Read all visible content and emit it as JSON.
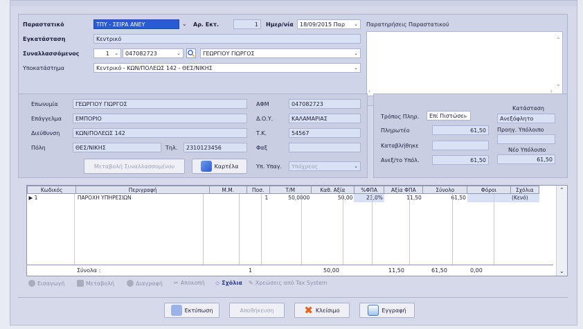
{
  "header": {
    "doc_label": "Παραστατικό",
    "doc_value": "ΤΠΥ - ΣΕΙΡΑ ΑΝΕΥ",
    "series_label": "Αρ. Εκτ.",
    "series_value": "1",
    "date_label": "Ημερ/νία",
    "date_value": "18/09/2015 Παρ",
    "notes_label": "Παρατηρήσεις Παραστατικού",
    "installation_label": "Εγκατάσταση",
    "installation_value": "Κεντρικό",
    "trader_label": "Συναλλασσόμενος",
    "trader_code": "1",
    "trader_afm": "047082723",
    "trader_name": "ΓΕΩΡΓΙΟΥ ΓΙΩΡΓΟΣ",
    "branch_label": "Υποκατάστημα",
    "branch_value": "Κεντρικό - ΚΩΝ/ΠΟΛΕΩΣ 142 - ΘΕΣ/ΝΙΚΗΣ"
  },
  "customer": {
    "name_label": "Επωνυμία",
    "name_value": "ΓΕΩΡΓΙΟΥ ΓΙΩΡΓΟΣ",
    "job_label": "Επάγγελμα",
    "job_value": "ΕΜΠΟΡΙΟ",
    "addr_label": "Διεύθυνση",
    "addr_value": "ΚΩΝ/ΠΟΛΕΩΣ 142",
    "city_label": "Πόλη",
    "city_value": "ΘΕΣ/ΝΙΚΗΣ",
    "tel_label": "Τηλ.",
    "tel_value": "2310123456",
    "afm_label": "ΑΦΜ",
    "afm_value": "047082723",
    "doy_label": "Δ.Ο.Υ.",
    "doy_value": "ΚΑΛΑΜΑΡΙΑΣ",
    "tk_label": "Τ.Κ.",
    "tk_value": "54567",
    "fax_label": "Φαξ",
    "fax_value": "",
    "vat_label": "Υπ. Υπαγ.",
    "vat_value": "Υπόχρεος",
    "change_button": "Μεταβολή Συναλλασσομένου",
    "card_button": "Καρτέλα"
  },
  "payment": {
    "method_label": "Τρόπος Πληρ.",
    "method_value": "Επί Πιστώσει",
    "payable_label": "Πληρωτέο",
    "payable_value": "61,50",
    "paid_label": "Καταβλήθηκε",
    "paid_value": "",
    "outstanding_label": "Ανεξ/το Υπόλ.",
    "outstanding_value": "61,50",
    "status_label": "Κατάσταση",
    "status_value": "Ανεξόφλητο",
    "prev_label": "Προηγ. Υπόλοιπο",
    "prev_value": "",
    "new_label": "Νέο Υπόλοιπο",
    "new_value": "61,50"
  },
  "grid": {
    "columns": [
      "Κωδικός",
      "Περιγραφή",
      "Μ.Μ.",
      "Ποσ.",
      "Τ/Μ",
      "Καθ. Αξία",
      "%ΦΠΑ",
      "Αξία ΦΠΑ",
      "Σύνολο",
      "Φόροι",
      "Σχόλια"
    ],
    "rows": [
      [
        "1",
        "ΠΑΡΟΧΗ ΥΠΗΡΕΣΙΩΝ",
        "",
        "1",
        "50,0000",
        "50,00",
        "23,0%",
        "11,50",
        "61,50",
        "",
        "(Κενό)"
      ]
    ],
    "totals_label": "Σύνολα :",
    "totals": {
      "qty": "1",
      "net": "50,00",
      "vat": "11,50",
      "total": "61,50",
      "taxes": "0,00"
    }
  },
  "toolbar": {
    "insert": "Εισαγωγή",
    "edit": "Μεταβολή",
    "delete": "Διαγραφή",
    "cut": "Αποκοπή",
    "comments": "Σχόλια",
    "tax_system": "Χρεώσεις από Tax System"
  },
  "footer": {
    "print": "Εκτύπωση",
    "save": "Αποθήκευση",
    "close": "Κλείσιμο",
    "record": "Εγγραφή"
  },
  "colors": {
    "accent": "#2a5bd7",
    "frame": "#d5d9ea",
    "field": "#d9e2f4",
    "close_x": "#e8621a"
  }
}
